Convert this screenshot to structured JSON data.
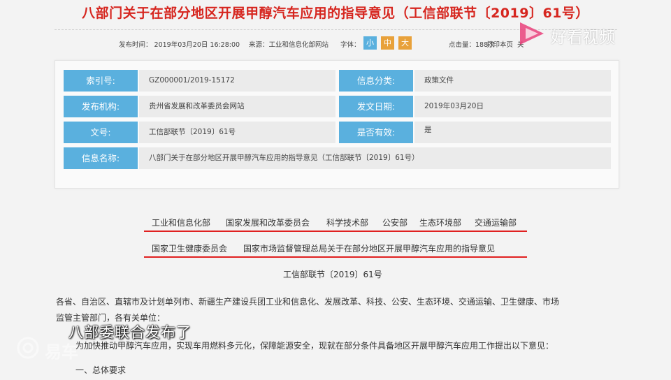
{
  "title": "八部门关于在部分地区开展甲醇汽车应用的指导意见（工信部联节〔2019〕61号）",
  "meta": {
    "publish_time": "发布时间：  2019年03月20日 16:28:00",
    "source": "来源：工业和信息化部网站",
    "font_label": "字体：",
    "font_small": "小",
    "font_medium": "中",
    "font_large": "大",
    "views": "点击量：188次",
    "print": "打印本页",
    "close": "关"
  },
  "info": {
    "index_label": "索引号:",
    "index_value": "GZ000001/2019-15172",
    "category_label": "信息分类:",
    "category_value": "政策文件",
    "publisher_label": "发布机构:",
    "publisher_value": "贵州省发展和改革委员会网站",
    "date_label": "发文日期:",
    "date_value": "2019年03月20日",
    "docno_label": "文号:",
    "docno_value": "工信部联节〔2019〕61号",
    "valid_label": "是否有效:",
    "valid_value": "是",
    "name_label": "信息名称:",
    "name_value": "八部门关于在部分地区开展甲醇汽车应用的指导意见（工信部联节〔2019〕61号）"
  },
  "departments": {
    "line1": [
      "工业和信息化部",
      "国家发展和改革委员会",
      "科学技术部",
      "公安部",
      "生态环境部",
      "交通运输部"
    ],
    "line2": [
      "国家卫生健康委员会",
      "国家市场监督管理总局关于在部分地区开展甲醇汽车应用的指导意见"
    ]
  },
  "doc_number": "工信部联节〔2019〕61号",
  "body": {
    "para1_line1": "各省、自治区、直辖市及计划单列市、新疆生产建设兵团工业和信息化、发展改革、科技、公安、生态环境、交通运输、卫生健康、市场",
    "para1_line2": "监管主管部门，各有关单位：",
    "para2": "为加快推动甲醇汽车应用，实现车用燃料多元化，保障能源安全，现就在部分条件具备地区开展甲醇汽车应用工作提出以下意见：",
    "heading1": "一、总体要求"
  },
  "caption": "八部委联合发布了",
  "watermark": {
    "brand": "好看视频",
    "left": "易车"
  }
}
